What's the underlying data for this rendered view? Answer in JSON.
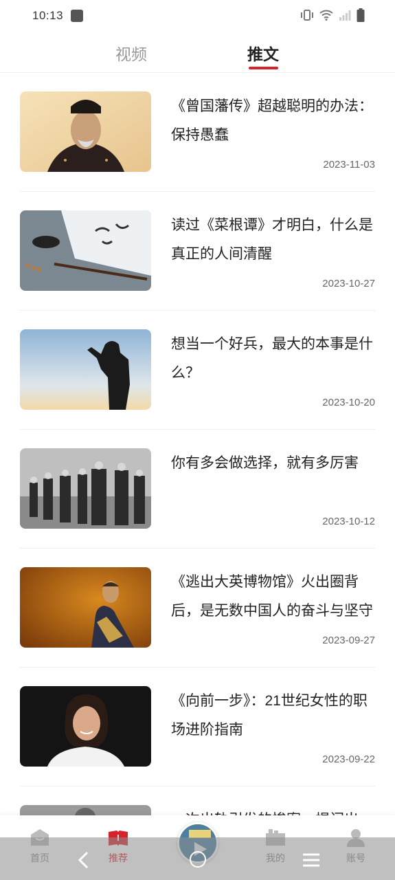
{
  "status": {
    "time": "10:13"
  },
  "tabs": [
    {
      "label": "视频",
      "active": false
    },
    {
      "label": "推文",
      "active": true
    }
  ],
  "accent_color": "#d7222b",
  "articles": [
    {
      "title": "《曾国藩传》超越聪明的办法：保持愚蠢",
      "date": "2023-11-03",
      "thumb": "portrait-qing-official"
    },
    {
      "title": "读过《菜根谭》才明白，什么是真正的人间清醒",
      "date": "2023-10-27",
      "thumb": "calligraphy-brush"
    },
    {
      "title": "想当一个好兵，最大的本事是什么？",
      "date": "2023-10-20",
      "thumb": "saluting-soldier-silhouette"
    },
    {
      "title": "你有多会做选择，就有多厉害",
      "date": "2023-10-12",
      "thumb": "historical-bw-photo"
    },
    {
      "title": "《逃出大英博物馆》火出圈背后，是无数中国人的奋斗与坚守",
      "date": "2023-09-27",
      "thumb": "ceramic-figurine"
    },
    {
      "title": "《向前一步》：21世纪女性的职场进阶指南",
      "date": "2023-09-22",
      "thumb": "woman-portrait"
    },
    {
      "title": "一次出轨引发的惨案，揭闪出",
      "date": "",
      "thumb": "partial"
    }
  ],
  "bottom_nav": {
    "home": "首页",
    "recommend": "推荐",
    "mine": "我的",
    "account": "账号"
  }
}
